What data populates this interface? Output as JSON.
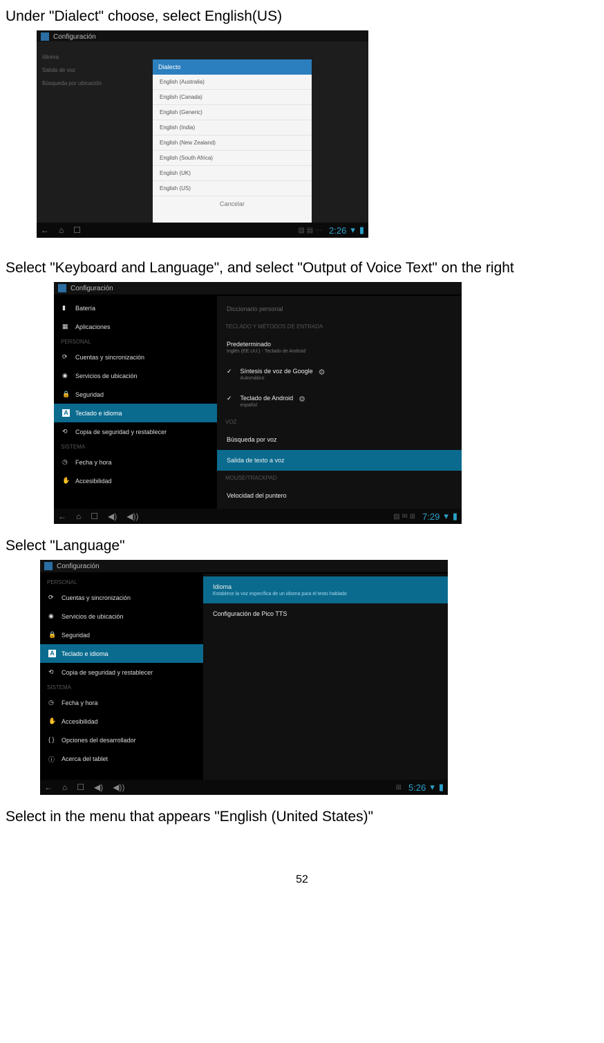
{
  "instructions": {
    "step1": "Under \"Dialect\" choose, select English(US)",
    "step2": "Select \"Keyboard and Language\", and select \"Output of Voice Text\" on the right",
    "step3": "Select \"Language\"",
    "step4": "Select in the menu that appears \"English (United States)\"",
    "page_number": "52"
  },
  "screenshot1": {
    "header_title": "Configuración",
    "side_items": [
      "Idioma",
      "Salida de voz",
      "Búsqueda por ubicación"
    ],
    "dialog_title": "Dialecto",
    "dialog_items": [
      "English (Australia)",
      "English (Canada)",
      "English (Generic)",
      "English (India)",
      "English (New Zealand)",
      "English (South Africa)",
      "English (UK)",
      "English (US)"
    ],
    "dialog_cancel": "Cancelar",
    "time": "2:26"
  },
  "screenshot2": {
    "header_title": "Configuración",
    "left": {
      "items_top": [
        {
          "icon": "battery-icon",
          "label": "Batería"
        },
        {
          "icon": "apps-icon",
          "label": "Aplicaciones"
        }
      ],
      "cat1": "PERSONAL",
      "items_personal": [
        {
          "icon": "sync-icon",
          "label": "Cuentas y sincronización"
        },
        {
          "icon": "location-icon",
          "label": "Servicios de ubicación"
        },
        {
          "icon": "lock-icon",
          "label": "Seguridad"
        },
        {
          "icon": "keyboard-icon",
          "label": "Teclado e idioma",
          "selected": true
        },
        {
          "icon": "backup-icon",
          "label": "Copia de seguridad y restablecer"
        }
      ],
      "cat2": "SISTEMA",
      "items_system": [
        {
          "icon": "clock-icon",
          "label": "Fecha y hora"
        },
        {
          "icon": "accessibility-icon",
          "label": "Accesibilidad"
        }
      ]
    },
    "right": {
      "top_truncated": "Diccionario personal",
      "header1": "TECLADO Y MÉTODOS DE ENTRADA",
      "item1": {
        "title": "Predeterminado",
        "sub": "Inglés (EE.UU.) - Teclado de Android"
      },
      "item2": {
        "title": "Síntesis de voz de Google",
        "sub": "Automático"
      },
      "item3": {
        "title": "Teclado de Android",
        "sub": "español"
      },
      "header2": "VOZ",
      "item4": {
        "title": "Búsqueda por voz"
      },
      "item5": {
        "title": "Salida de texto a voz",
        "selected": true
      },
      "header3": "MOUSE/TRACKPAD",
      "item6": {
        "title": "Velocidad del puntero"
      }
    },
    "time": "7:29"
  },
  "screenshot3": {
    "header_title": "Configuración",
    "left": {
      "cat1": "PERSONAL",
      "items_personal": [
        {
          "icon": "sync-icon",
          "label": "Cuentas y sincronización"
        },
        {
          "icon": "location-icon",
          "label": "Servicios de ubicación"
        },
        {
          "icon": "lock-icon",
          "label": "Seguridad"
        },
        {
          "icon": "keyboard-icon",
          "label": "Teclado e idioma",
          "selected": true
        },
        {
          "icon": "backup-icon",
          "label": "Copia de seguridad y restablecer"
        }
      ],
      "cat2": "SISTEMA",
      "items_system": [
        {
          "icon": "clock-icon",
          "label": "Fecha y hora"
        },
        {
          "icon": "accessibility-icon",
          "label": "Accesibilidad"
        },
        {
          "icon": "dev-icon",
          "label": "Opciones del desarrollador"
        },
        {
          "icon": "info-icon",
          "label": "Acerca del tablet"
        }
      ]
    },
    "right": {
      "item1": {
        "title": "Idioma",
        "sub": "Establece la voz específica de un idioma para el texto hablado",
        "selected": true
      },
      "item2": {
        "title": "Configuración de Pico TTS"
      }
    },
    "time": "5:26"
  }
}
